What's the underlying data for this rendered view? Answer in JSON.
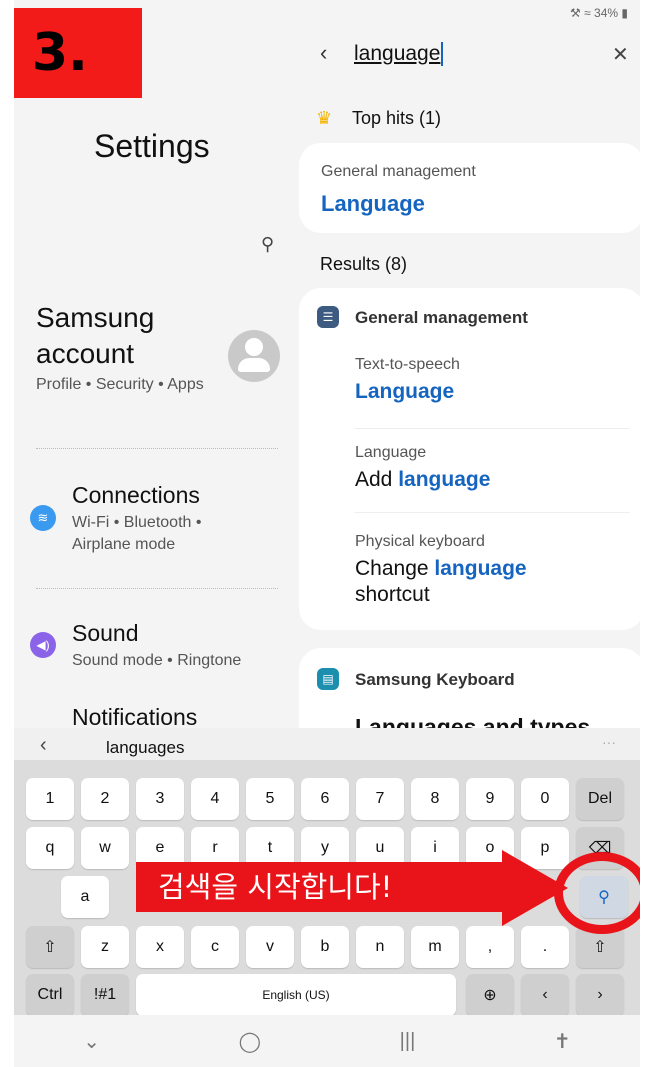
{
  "status": "34%",
  "step_label": "3.",
  "settings": {
    "title": "Settings",
    "account_title": "Samsung account",
    "account_sub": "Profile • Security • Apps",
    "items": [
      {
        "title": "Connections",
        "sub": "Wi-Fi • Bluetooth • Airplane mode"
      },
      {
        "title": "Sound",
        "sub": "Sound mode • Ringtone"
      },
      {
        "title": "Notifications"
      }
    ]
  },
  "search": {
    "query": "language",
    "top_hits": "Top hits (1)",
    "results": "Results (8)",
    "top": {
      "category": "General management",
      "title": "Language"
    },
    "group1": {
      "header": "General management",
      "entries": [
        {
          "cat": "Text-to-speech",
          "title": "Language"
        },
        {
          "cat": "Language",
          "pre": "Add ",
          "hl": "language",
          "post": ""
        },
        {
          "cat": "Physical keyboard",
          "pre": "Change ",
          "hl": "language",
          "post": "shortcut"
        }
      ]
    },
    "group2": {
      "header": "Samsung Keyboard",
      "entry": "Languages and types"
    }
  },
  "keyboard": {
    "suggestion": "languages",
    "row1": [
      "1",
      "2",
      "3",
      "4",
      "5",
      "6",
      "7",
      "8",
      "9",
      "0",
      "Del"
    ],
    "row2": [
      "q",
      "w",
      "e",
      "r",
      "t",
      "y",
      "u",
      "i",
      "o",
      "p"
    ],
    "row4": [
      "z",
      "x",
      "c",
      "v",
      "b",
      "n",
      "m",
      ",",
      "."
    ],
    "ctrl": "Ctrl",
    "sym": "!#1",
    "space": "English (US)"
  },
  "annotation": "검색을 시작합니다!"
}
